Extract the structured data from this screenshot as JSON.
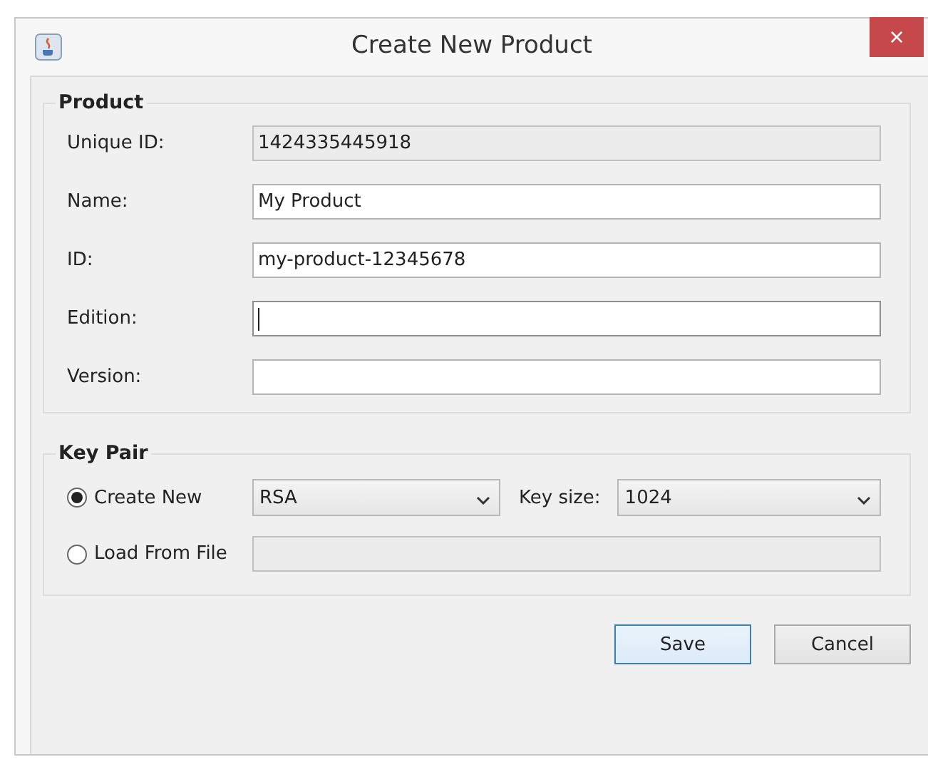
{
  "window": {
    "title": "Create New Product",
    "close": "×"
  },
  "product": {
    "title": "Product",
    "fields": [
      {
        "label": "Unique ID:",
        "value": "1424335445918",
        "disabled": true,
        "focused": false
      },
      {
        "label": "Name:",
        "value": "My Product",
        "disabled": false,
        "focused": false
      },
      {
        "label": "ID:",
        "value": "my-product-12345678",
        "disabled": false,
        "focused": false
      },
      {
        "label": "Edition:",
        "disabled": false,
        "focused": true
      },
      {
        "label": "Version:",
        "disabled": false,
        "focused": false
      }
    ]
  },
  "key_pair": {
    "title": "Key Pair",
    "create_new": {
      "label": "Create New",
      "selected": true,
      "algorithm": "RSA",
      "key_size_label": "Key size:",
      "key_size": "1024"
    },
    "load_from_file": {
      "label": "Load From File",
      "selected": false,
      "path_disabled": true
    }
  },
  "buttons": [
    {
      "label": "Save",
      "default": true
    },
    {
      "label": "Cancel",
      "default": false
    }
  ]
}
